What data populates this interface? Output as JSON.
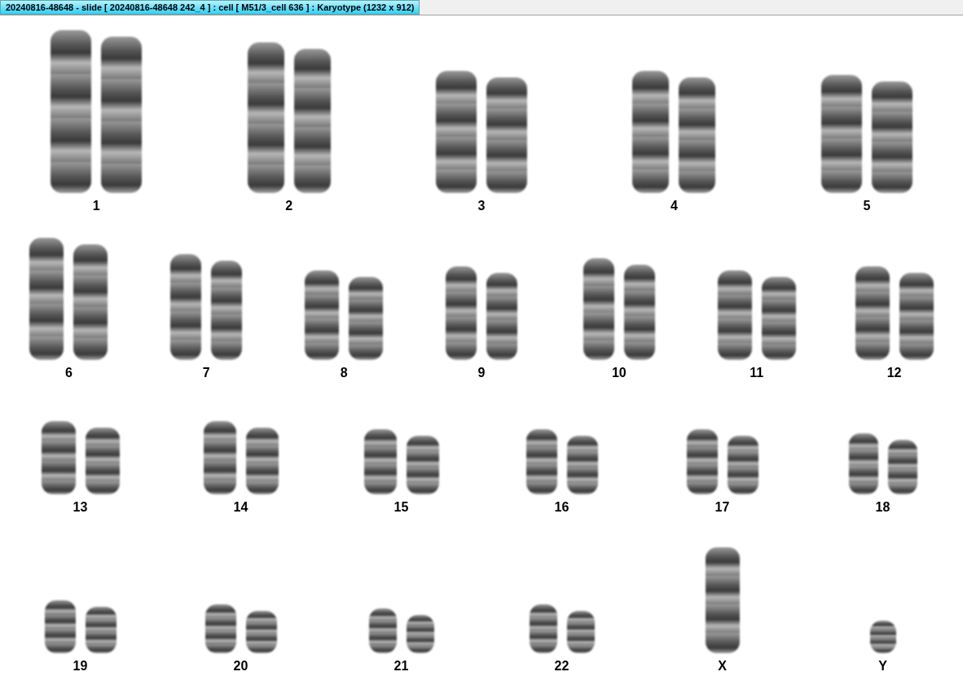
{
  "window": {
    "title": "20240816-48648 - slide [ 20240816-48648 242_4 ] : cell [ M51/3_cell 636 ] : Karyotype  (1232 x 912)"
  },
  "rows": [
    [
      {
        "label": "1",
        "kind": "pair"
      },
      {
        "label": "2",
        "kind": "pair"
      },
      {
        "label": "3",
        "kind": "pair"
      },
      {
        "label": "4",
        "kind": "pair"
      },
      {
        "label": "5",
        "kind": "pair"
      }
    ],
    [
      {
        "label": "6",
        "kind": "pair"
      },
      {
        "label": "7",
        "kind": "pair"
      },
      {
        "label": "8",
        "kind": "pair"
      },
      {
        "label": "9",
        "kind": "pair"
      },
      {
        "label": "10",
        "kind": "pair"
      },
      {
        "label": "11",
        "kind": "pair"
      },
      {
        "label": "12",
        "kind": "pair"
      }
    ],
    [
      {
        "label": "13",
        "kind": "pair"
      },
      {
        "label": "14",
        "kind": "pair"
      },
      {
        "label": "15",
        "kind": "pair"
      },
      {
        "label": "16",
        "kind": "pair"
      },
      {
        "label": "17",
        "kind": "pair"
      },
      {
        "label": "18",
        "kind": "pair"
      }
    ],
    [
      {
        "label": "19",
        "kind": "pair"
      },
      {
        "label": "20",
        "kind": "pair"
      },
      {
        "label": "21",
        "kind": "pair"
      },
      {
        "label": "22",
        "kind": "pair"
      },
      {
        "label": "X",
        "kind": "single"
      },
      {
        "label": "Y",
        "kind": "single"
      }
    ]
  ]
}
